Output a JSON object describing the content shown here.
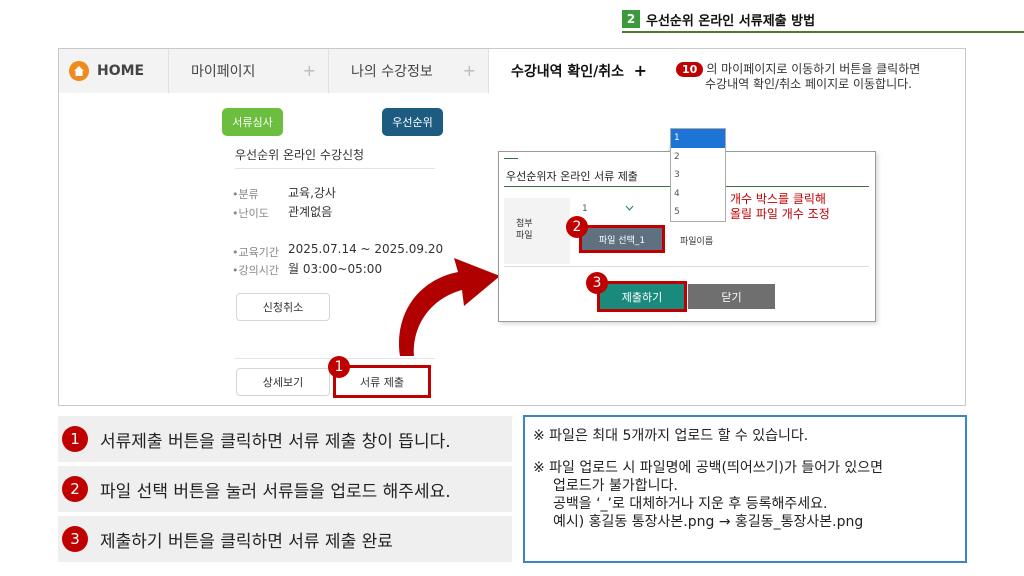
{
  "section": {
    "number": "2",
    "title": "우선순위 온라인 서류제출 방법"
  },
  "nav": {
    "home": "HOME",
    "items": [
      "마이페이지",
      "나의 수강정보",
      "수강내역 확인/취소"
    ],
    "plus": "+"
  },
  "note10": {
    "badge": "10",
    "line1": "의 마이페이지로 이동하기 버튼을 클릭하면",
    "line2": "수강내역 확인/취소 페이지로 이동합니다."
  },
  "card": {
    "pill_review": "서류심사",
    "pill_priority": "우선순위",
    "title": "우선순위 온라인 수강신청",
    "category_label": "•분류",
    "category_value": "교육,강사",
    "level_label": "•난이도",
    "level_value": "관계없음",
    "period_label": "•교육기간",
    "period_value": "2025.07.14 ~ 2025.09.20",
    "time_label": "•강의시간",
    "time_value": "월 03:00~05:00",
    "cancel_btn": "신청취소",
    "detail_btn": "상세보기",
    "submit_btn": "서류 제출"
  },
  "modal": {
    "title": "우선순위자 온라인 서류 제출",
    "label_line1": "첨부",
    "label_line2": "파일",
    "count_value": "1",
    "file_btn": "파일 선택_1",
    "file_name": "파일이름",
    "submit": "제출하기",
    "close": "닫기"
  },
  "dropdown": {
    "options": [
      "1",
      "2",
      "3",
      "4",
      "5"
    ],
    "selected": "1"
  },
  "callout": {
    "line1": "개수 박스를 클릭해",
    "line2": "올릴 파일 개수 조정"
  },
  "markers": [
    "1",
    "2",
    "3"
  ],
  "steps": [
    {
      "num": "1",
      "text": "서류제출 버튼을 클릭하면 서류 제출 창이 뜹니다."
    },
    {
      "num": "2",
      "text": "파일 선택 버튼을 눌러 서류들을 업로드 해주세요."
    },
    {
      "num": "3",
      "text": "제출하기 버튼을 클릭하면 서류 제출 완료"
    }
  ],
  "notice": {
    "line1": "※ 파일은 최대 5개까지 업로드 할 수 있습니다.",
    "line2": "※ 파일 업로드 시 파일명에 공백(띄어쓰기)가 들어가 있으면",
    "line3": "업로드가 불가합니다.",
    "line4": "공백을 ‘_’로 대체하거나 지운 후 등록해주세요.",
    "line5": "예시) 홍길동 통장사본.png → 홍길동_통장사본.png"
  },
  "colors": {
    "accent_red": "#c00000",
    "green": "#3b9a3b",
    "teal": "#1a8a7c",
    "navy": "#1d5c80",
    "notice_border": "#3a85c6"
  },
  "icons": {
    "home": "home-icon",
    "dropdown": "chevron-down-icon",
    "arrow": "curved-arrow-icon"
  }
}
